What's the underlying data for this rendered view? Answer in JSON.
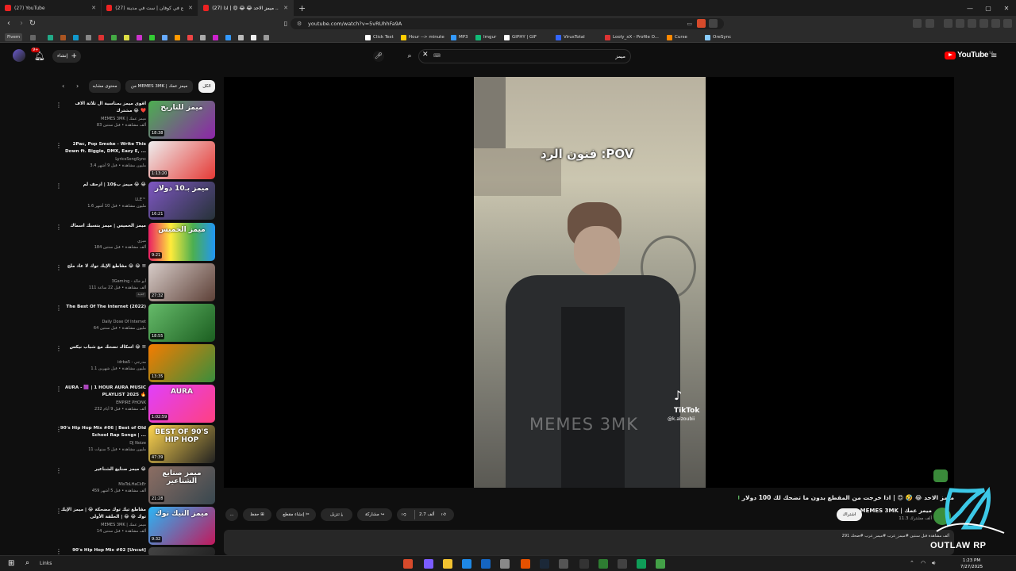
{
  "browser": {
    "tabs": [
      {
        "label": "(27) YouTube"
      },
      {
        "label": "(27) أسبوع في كوفان | ست في مدينة ..."
      },
      {
        "label": "(27) ميمز الاحد 😂 😂 😍 | اذا ..."
      }
    ],
    "url": "youtube.com/watch?v=5vRUhhFa9A",
    "window_controls": [
      "—",
      "▢",
      "✕"
    ]
  },
  "bookmarks": [
    {
      "label": "Fivem"
    },
    {
      "label": "Click Test"
    },
    {
      "label": "Hour --> minute"
    },
    {
      "label": "MP3"
    },
    {
      "label": "Imgur"
    },
    {
      "label": "GIPHY | GIF"
    },
    {
      "label": "VirusTotal"
    },
    {
      "label": "Looly_xX - Profile O..."
    },
    {
      "label": "Curse"
    },
    {
      "label": "OreSync"
    }
  ],
  "youtube_header": {
    "logo_text": "YouTube",
    "region": "SA",
    "create_label": "إنشاء",
    "notifications_count": "9+",
    "search_value": "ميمز",
    "search_placeholder": "بحث"
  },
  "chips": [
    {
      "label": "الكل"
    },
    {
      "label": "من MEMES 3MK | ميمز عمك"
    },
    {
      "label": "محتوى مشابه"
    }
  ],
  "recommendations": [
    {
      "title": "اقوى ميمز بمناسبة ال ثلاثة الاف مشترك 😂 ❤️",
      "channel": "MEMES 3MK | ميمز عمك",
      "meta": "83 ألف مشاهدة • قبل سنتين",
      "duration": "18:38",
      "thumb_text": "ميمز للتاريخ"
    },
    {
      "title": "2Pac, Pop Smoke - Write This Down ft. Biggie, DMX, Eazy E, ...",
      "channel": "LyricsSongSync",
      "meta": "3.4 مليون مشاهدة • قبل 9 أشهر",
      "duration": "1:13:20",
      "thumb_text": ""
    },
    {
      "title": "ميمز ب$10 | ازحف لم 😂 😂",
      "channel": "LLE™",
      "meta": "1.6 مليون مشاهدة • قبل 10 أشهر",
      "duration": "16:21",
      "thumb_text": "ميمز بـ10 دولار"
    },
    {
      "title": "ميمز الخميس | ميمز بتسبك اسماك",
      "channel": "ميزي",
      "meta": "184 ألف مشاهدة • قبل سنتين",
      "duration": "9:21",
      "thumb_text": "ميمز الخميس"
    },
    {
      "title": "مقاطع الإيك توك لا عاد ملح 😂 😂 !!",
      "channel": "3Gaming - أبو خالد",
      "meta": "111 ألف مشاهدة • قبل 22 ساعة",
      "badge": "جديد",
      "duration": "27:32",
      "thumb_text": ""
    },
    {
      "title": "The Best Of The Internet (2022)",
      "channel": "Daily Dose Of Internet",
      "meta": "64 مليون مشاهدة • قبل سنتين",
      "duration": "18:55",
      "thumb_text": ""
    },
    {
      "title": "اسكاك تضحك مع شباب نيكس 😂 !!",
      "channel": "idrba5 - مدرجي",
      "meta": "1.1 مليون مشاهدة • قبل شهرين",
      "duration": "13:35",
      "thumb_text": ""
    },
    {
      "title": "AURA - 🟪 | 1 HOUR AURA MUSIC PLAYLIST 2025 🔥",
      "channel": "EMPIRE PHONK",
      "meta": "232 ألف مشاهدة • قبل 9 أيام",
      "duration": "1:02:59",
      "thumb_text": "AURA"
    },
    {
      "title": "90's Hip Hop Mix #06 | Best of Old School Rap Songs | ...",
      "channel": "DJ Noize",
      "meta": "11 مليون مشاهدة • قبل 5 سنوات",
      "duration": "47:39",
      "thumb_text": "BEST OF 90'S HIP HOP"
    },
    {
      "title": "ميمز صنايع الشناعير 😂",
      "channel": "MisToLHaCkEr",
      "meta": "459 ألف مشاهدة • قبل 5 أشهر",
      "duration": "21:28",
      "thumb_text": "ميمز صنايع الشناعير"
    },
    {
      "title": "مقاطع تيك توك مضحكة 😂 | ميمز الإيك توك 😂 😂 | الحلقة الأولى",
      "channel": "MEMES 3MK | ميمز عمك",
      "meta": "14 ألف مشاهدة • قبل سنتين",
      "duration": "9:32",
      "thumb_text": "ميمز التيك توك"
    },
    {
      "title": "90's Hip Hop Mix #02 [Uncut]",
      "channel": "",
      "meta": "",
      "duration": "",
      "thumb_text": ""
    }
  ],
  "video": {
    "overlay_text": "فنون الرد :POV",
    "watermark": "MEMES 3MK",
    "tiktok_label": "TikTok",
    "tiktok_user": "@k.alzoubii"
  },
  "video_info": {
    "title": "ميمز الاحد 😂 🤣 😍 | اذا خرجت من المقطع بدون ما تضحك لك 100 دولار 💵",
    "channel": "MEMES 3MK | ميمز عمك",
    "subscribers": "11.3 ألف مشترك",
    "subscribe_label": "اشتراك",
    "likes": "2.7 ألف",
    "share_label": "مشاركة",
    "download_label": "تنزيل",
    "clip_label": "إنشاء مقطع",
    "save_label": "حفظ",
    "more_label": "...",
    "description_meta": "291 ألف مشاهدة قبل سنتين #ميمز_عرب #ميمز_عرب #ضحك"
  },
  "taskbar": {
    "search_label": "Links",
    "time": "1:23 PM",
    "date": "7/27/2025"
  },
  "overlay_logo": {
    "text": "OUTLAW RP"
  },
  "colors": {
    "yt_red": "#ff0000",
    "background": "#0f0f0f",
    "chip": "#272727",
    "text": "#f1f1f1",
    "subtext": "#aaaaaa"
  }
}
